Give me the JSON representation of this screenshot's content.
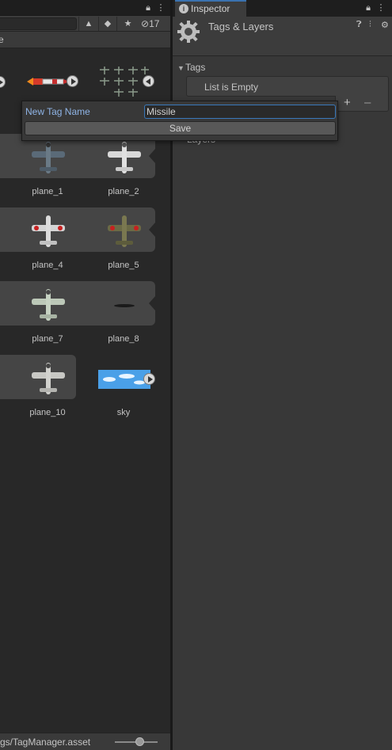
{
  "project_panel": {
    "path_fragment": "e",
    "hidden_count": "17",
    "footer_path": "gs/TagManager.asset",
    "assets": [
      {
        "label": "plane_1"
      },
      {
        "label": "plane_2"
      },
      {
        "label": "plane_4"
      },
      {
        "label": "plane_5"
      },
      {
        "label": "plane_7"
      },
      {
        "label": "plane_8"
      },
      {
        "label": "plane_10"
      },
      {
        "label": "sky"
      }
    ]
  },
  "inspector": {
    "tab_label": "Inspector",
    "title": "Tags & Layers",
    "tags_section": "Tags",
    "tags_list_empty": "List is Empty",
    "layers_section": "Layers"
  },
  "popup": {
    "label": "New Tag Name",
    "input_value": "Missile",
    "save_label": "Save"
  },
  "colors": {
    "accent": "#3a72b0",
    "label_blue": "#8fb4e6",
    "panel_dark": "#282828",
    "panel": "#383838"
  }
}
